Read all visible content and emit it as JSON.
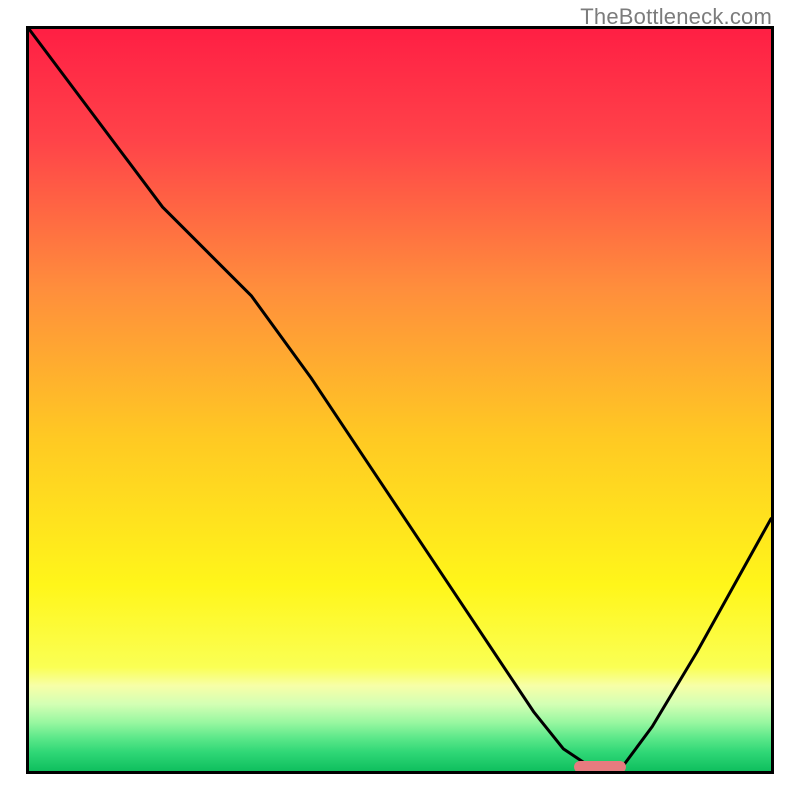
{
  "watermark": "TheBottleneck.com",
  "chart_data": {
    "type": "line",
    "title": "",
    "xlabel": "",
    "ylabel": "",
    "xlim": [
      0,
      100
    ],
    "ylim": [
      0,
      100
    ],
    "grid": false,
    "legend": false,
    "background_gradient": {
      "type": "vertical",
      "stops": [
        {
          "pos": 0.0,
          "color": "#ff1f44"
        },
        {
          "pos": 0.15,
          "color": "#ff4349"
        },
        {
          "pos": 0.35,
          "color": "#ff8e3c"
        },
        {
          "pos": 0.55,
          "color": "#ffc923"
        },
        {
          "pos": 0.75,
          "color": "#fff61a"
        },
        {
          "pos": 0.86,
          "color": "#faff54"
        },
        {
          "pos": 0.885,
          "color": "#f7ffa7"
        },
        {
          "pos": 0.91,
          "color": "#d3ffb4"
        },
        {
          "pos": 0.935,
          "color": "#97f7a0"
        },
        {
          "pos": 0.955,
          "color": "#5de88a"
        },
        {
          "pos": 0.975,
          "color": "#2fd776"
        },
        {
          "pos": 1.0,
          "color": "#0fbf5e"
        }
      ]
    },
    "series": [
      {
        "name": "bottleneck-curve",
        "color": "#000000",
        "x": [
          0,
          6,
          12,
          18,
          24,
          30,
          38,
          46,
          54,
          62,
          68,
          72,
          75,
          78,
          80,
          84,
          90,
          95,
          100
        ],
        "y": [
          100,
          92,
          84,
          76,
          70,
          64,
          53,
          41,
          29,
          17,
          8,
          3,
          1,
          0.6,
          0.6,
          6,
          16,
          25,
          34
        ]
      }
    ],
    "marker": {
      "name": "optimal-range",
      "color": "#e77b7f",
      "x_start": 73.5,
      "x_end": 80.5,
      "y": 0.6
    }
  }
}
